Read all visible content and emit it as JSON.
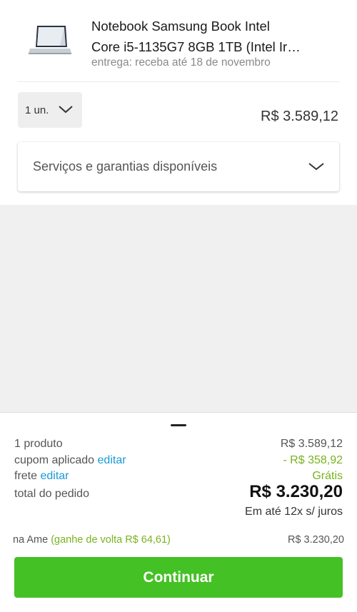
{
  "product": {
    "title_line1": "Notebook Samsung Book Intel",
    "title_line2": "Core i5-1135G7 8GB 1TB (Intel Ir…",
    "delivery": "entrega: receba até 18 de novembro",
    "quantity_label": "1 un.",
    "price": "R$ 3.589,12"
  },
  "services": {
    "label": "Serviços e garantias disponíveis"
  },
  "summary": {
    "products_label": "1 produto",
    "products_value": "R$ 3.589,12",
    "coupon_label": "cupom aplicado",
    "coupon_edit": "editar",
    "coupon_value": "- R$ 358,92",
    "shipping_label": "frete",
    "shipping_edit": "editar",
    "shipping_value": "Grátis",
    "total_label": "total do pedido",
    "total_value": "R$ 3.230,20",
    "installments": "Em até 12x s/ juros",
    "ame_label": "na Ame",
    "ame_cashback": "(ganhe de volta R$ 64,61)",
    "ame_value": "R$ 3.230,20"
  },
  "actions": {
    "continue_label": "Continuar"
  },
  "colors": {
    "accent_green": "#44c125",
    "link_blue": "#1a9ad6",
    "discount_green": "#79b31f"
  },
  "icons": {
    "quantity_dropdown": "chevron-down-icon",
    "services_expand": "chevron-down-icon",
    "sheet_handle": "drag-handle-icon"
  }
}
